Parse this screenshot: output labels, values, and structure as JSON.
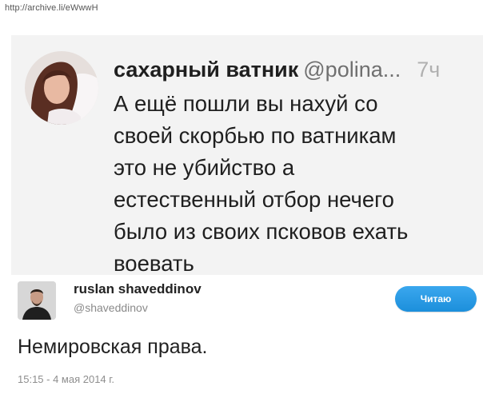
{
  "archive_url": "http://archive.li/eWwwH",
  "tweet_main": {
    "display_name": "сахарный ватник",
    "handle": "@polina...",
    "time": "7ч",
    "body_lines": [
      "А ещё пошли вы нахуй со",
      "своей скорбью по ватникам",
      "это не убийство а",
      "естественный отбор нечего",
      "было из своих псковов ехать",
      "воевать"
    ],
    "background_color": "#f3f3f3"
  },
  "tweet_reply": {
    "display_name": "ruslan shaveddinov",
    "handle": "@shaveddinov",
    "follow_label": "Читаю",
    "text": "Немировская права.",
    "date": "15:15 - 4 мая 2014 г.",
    "accent_color": "#1da1f2"
  }
}
